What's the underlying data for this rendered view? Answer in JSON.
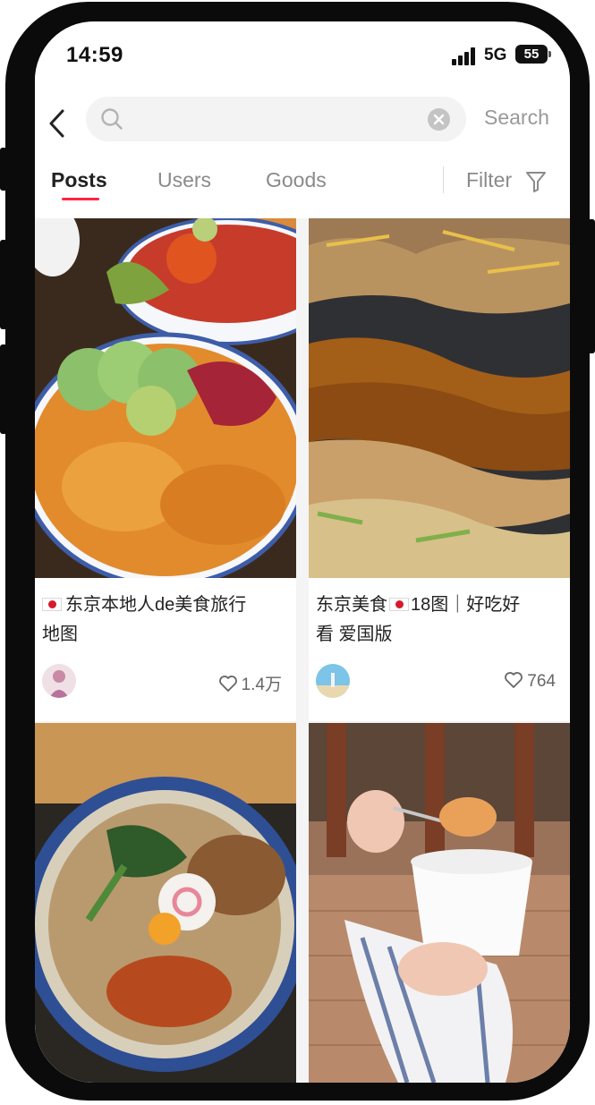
{
  "status_bar": {
    "time": "14:59",
    "network": "5G",
    "battery": "55"
  },
  "search": {
    "value": "",
    "placeholder": "",
    "button_label": "Search"
  },
  "tabs": [
    {
      "label": "Posts",
      "active": true
    },
    {
      "label": "Users",
      "active": false
    },
    {
      "label": "Goods",
      "active": false
    }
  ],
  "filter": {
    "label": "Filter",
    "icon": "filter-icon"
  },
  "posts": [
    {
      "title_part1": "东京本地人de美食旅行",
      "title_part2": "地图",
      "likes": "1.4万"
    },
    {
      "title_part1": "东京美食",
      "title_part2": "18图｜好吃好",
      "title_part3": "看 爱国版",
      "likes": "764"
    }
  ],
  "colors": {
    "accent": "#ff2442",
    "frame": "#0b0b0b"
  }
}
